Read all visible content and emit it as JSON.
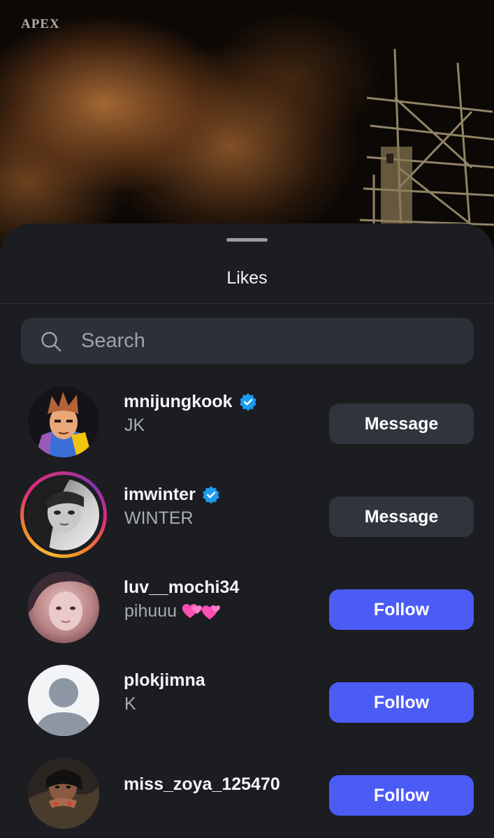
{
  "photo": {
    "brand": "APEX"
  },
  "sheet": {
    "title": "Likes",
    "search": {
      "placeholder": "Search",
      "value": ""
    }
  },
  "users": [
    {
      "username": "mnijungkook",
      "display_name": "JK",
      "verified": true,
      "story_ring": false,
      "action": "Message",
      "avatar_icon": "anime-avatar-icon"
    },
    {
      "username": "imwinter",
      "display_name": "WINTER",
      "verified": true,
      "story_ring": true,
      "action": "Message",
      "avatar_icon": "photo-avatar-icon"
    },
    {
      "username": "luv__mochi34",
      "display_name": "pihuuu",
      "display_emoji": "💕💕",
      "verified": false,
      "story_ring": false,
      "action": "Follow",
      "avatar_icon": "photo-avatar-icon"
    },
    {
      "username": "plokjimna",
      "display_name": "K",
      "verified": false,
      "story_ring": false,
      "action": "Follow",
      "avatar_icon": "default-profile-icon"
    },
    {
      "username": "miss_zoya_125470",
      "display_name": "",
      "verified": false,
      "story_ring": false,
      "action": "Follow",
      "avatar_icon": "photo-avatar-icon"
    }
  ],
  "colors": {
    "sheet_bg": "#1b1d21",
    "follow_button": "#4b5cf5",
    "message_button": "#30343c",
    "verified_badge": "#1d9bf0"
  }
}
